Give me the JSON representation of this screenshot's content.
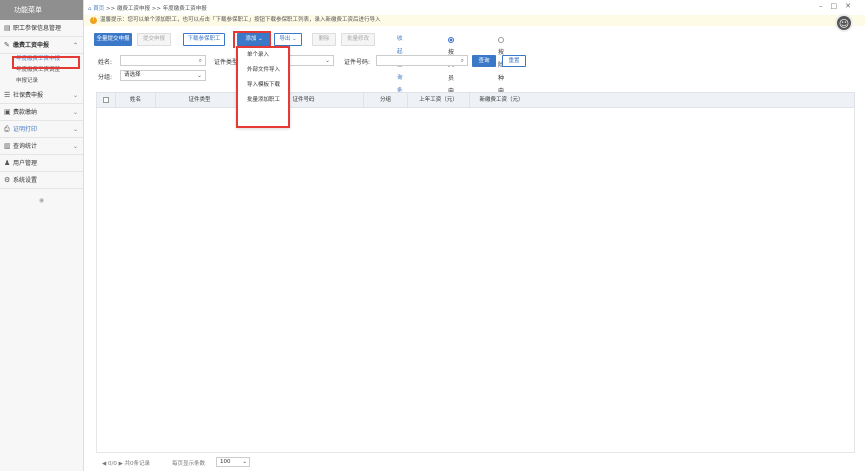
{
  "sidebar": {
    "title": "功能菜单",
    "items": [
      {
        "label": "职工参保信息管理",
        "icon": "document-icon"
      },
      {
        "label": "缴费工资申报",
        "icon": "edit-icon"
      },
      {
        "label": "社保费申报",
        "icon": "list-icon"
      },
      {
        "label": "费款缴纳",
        "icon": "money-icon"
      },
      {
        "label": "证明打印",
        "icon": "printer-icon"
      },
      {
        "label": "查询统计",
        "icon": "chart-icon"
      },
      {
        "label": "用户管理",
        "icon": "user-icon"
      },
      {
        "label": "系统设置",
        "icon": "gear-icon"
      }
    ],
    "subitems": [
      "年度缴费工资申报",
      "年度缴费工资调整",
      "申报记录"
    ]
  },
  "header": {
    "home": "首页",
    "crumb1": ">> 缴费工资申报",
    "crumb2": ">> 年度缴费工资申报"
  },
  "hint": "温馨提示：您可以单个添加职工，也可以点击「下载参保职工」按钮下载参保职工列表，录入新缴费工资后进行导入",
  "toolbar": {
    "submit_all": "全量提交申报",
    "submit": "提交申报",
    "download": "下载参保职工",
    "add": "添加",
    "export": "导出",
    "delete": "删除",
    "batch_edit": "批量修改",
    "collapse": "收起查询条件",
    "radio_person": "按人员申报",
    "radio_type": "按险种申报"
  },
  "form": {
    "name_label": "姓名:",
    "idtype_label": "证件类型:",
    "idno_label": "证件号码:",
    "group_label": "分组:",
    "group_value": "请选择",
    "query": "查询",
    "reset": "重置"
  },
  "table": {
    "columns": [
      "姓名",
      "证件类型",
      "证件号码",
      "分组",
      "上年工资（元）",
      "新缴费工资（元）"
    ]
  },
  "footer": {
    "pager": "◀ 0/0 ▶ 共0条记录",
    "size_label": "每页显示条数",
    "size_value": "100"
  },
  "dropdown": {
    "items": [
      "单个录入",
      "外部文件导入",
      "导入模板下载",
      "批量添加职工"
    ]
  }
}
